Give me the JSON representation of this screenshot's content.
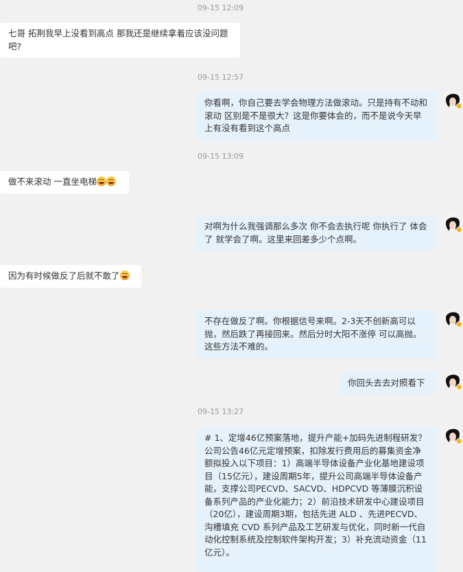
{
  "messages": [
    {
      "time": "09-15 12:09"
    },
    {
      "text": "七哥 拓荆我早上没看到高点 那我还是继续拿着应该没问题吧?"
    },
    {
      "time": "09-15 12:57"
    },
    {
      "text": "你看啊，你自己要去学会物理方法做滚动。只是持有不动和滚动  区别是不是很大？这是你要体会的，而不是说今天早上有没有看到这个高点"
    },
    {
      "time": "09-15 13:09"
    },
    {
      "text": "做不来滚动 一直坐电梯"
    },
    {
      "text": "对啊为什么我强调那么多次 你不会去执行呢  你执行了 体会了 就学会了啊。这里来回差多少个点啊。"
    },
    {
      "text": "因为有时候做反了后就不敢了"
    },
    {
      "text": "不存在做反了啊。你根据信号来啊。2-3天不创新高可以抛，然后跌了再接回来。然后分时大阳不涨停 可以高抛。这些方法不难的。"
    },
    {
      "text": "你回头去去对照看下"
    },
    {
      "time": "09-15 13:27"
    },
    {
      "text": "# 1、定增46亿预案落地，提升产能+加码先进制程研发？公司公告46亿元定增预案，扣除发行费用后的募集资金净额拟投入以下项目：1）高端半导体设备产业化基地建设项目（15亿元），建设周期5年，提升公司高端半导体设备产能，支撑公司PECVD、SACVD、HDPCVD 等薄膜沉积设备系列产品的产业化能力；2）前沿技术研发中心建设项目（20亿），建设周期3期，包括先进 ALD 、先进PECVD、沟槽填充 CVD 系列产品及工艺研发与优化，同时新一代自动化控制系统及控制软件架构开发；3）补充流动资金（11亿元）。"
    }
  ],
  "emoji_name": "laughing-tears-emoji",
  "colors": {
    "incoming": "#ffffff",
    "outgoing": "#e6f2fb",
    "background": "#f1f1f1"
  }
}
